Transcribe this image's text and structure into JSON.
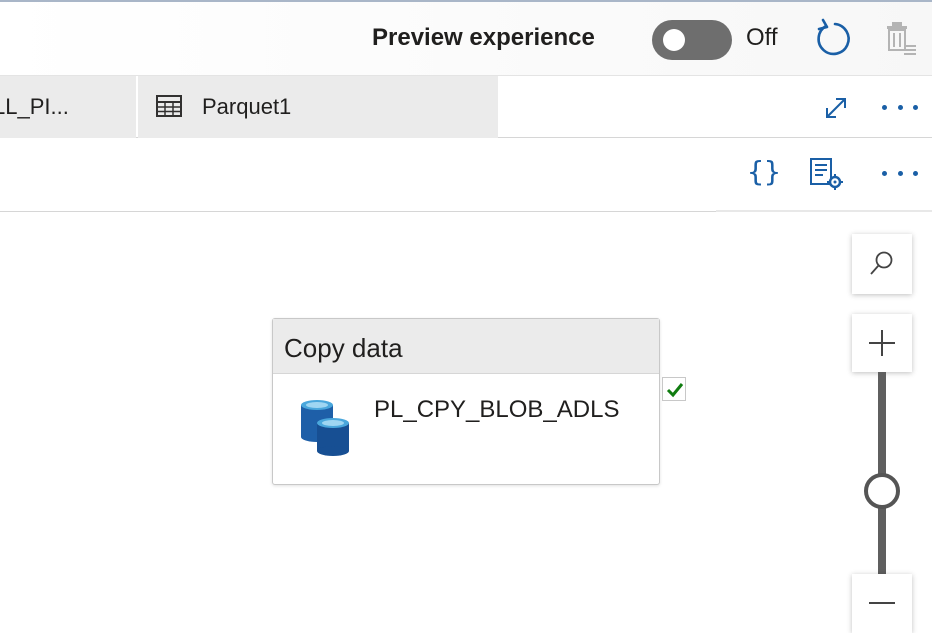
{
  "topbar": {
    "preview_label": "Preview experience",
    "toggle_state": "Off",
    "refresh_icon": "refresh-icon",
    "delete_icon": "delete-icon"
  },
  "tabs": {
    "items": [
      {
        "label": "LL_PI...",
        "icon": "pipeline-icon"
      },
      {
        "label": "Parquet1",
        "icon": "table-icon"
      }
    ],
    "expand_icon": "expand-icon",
    "more_icon": "more-icon"
  },
  "toolbar": {
    "code_label": "{}",
    "properties_icon": "properties-icon",
    "more_icon": "more-icon"
  },
  "canvas": {
    "activity": {
      "type_label": "Copy data",
      "name": "PL_CPY_BLOB_ADLS",
      "status": "succeeded"
    },
    "zoom": {
      "level": 0.5
    }
  },
  "colors": {
    "accent": "#1a5fa6",
    "toggle_off": "#6e6e6e",
    "success": "#107c10",
    "tab_background": "#ebebeb"
  }
}
